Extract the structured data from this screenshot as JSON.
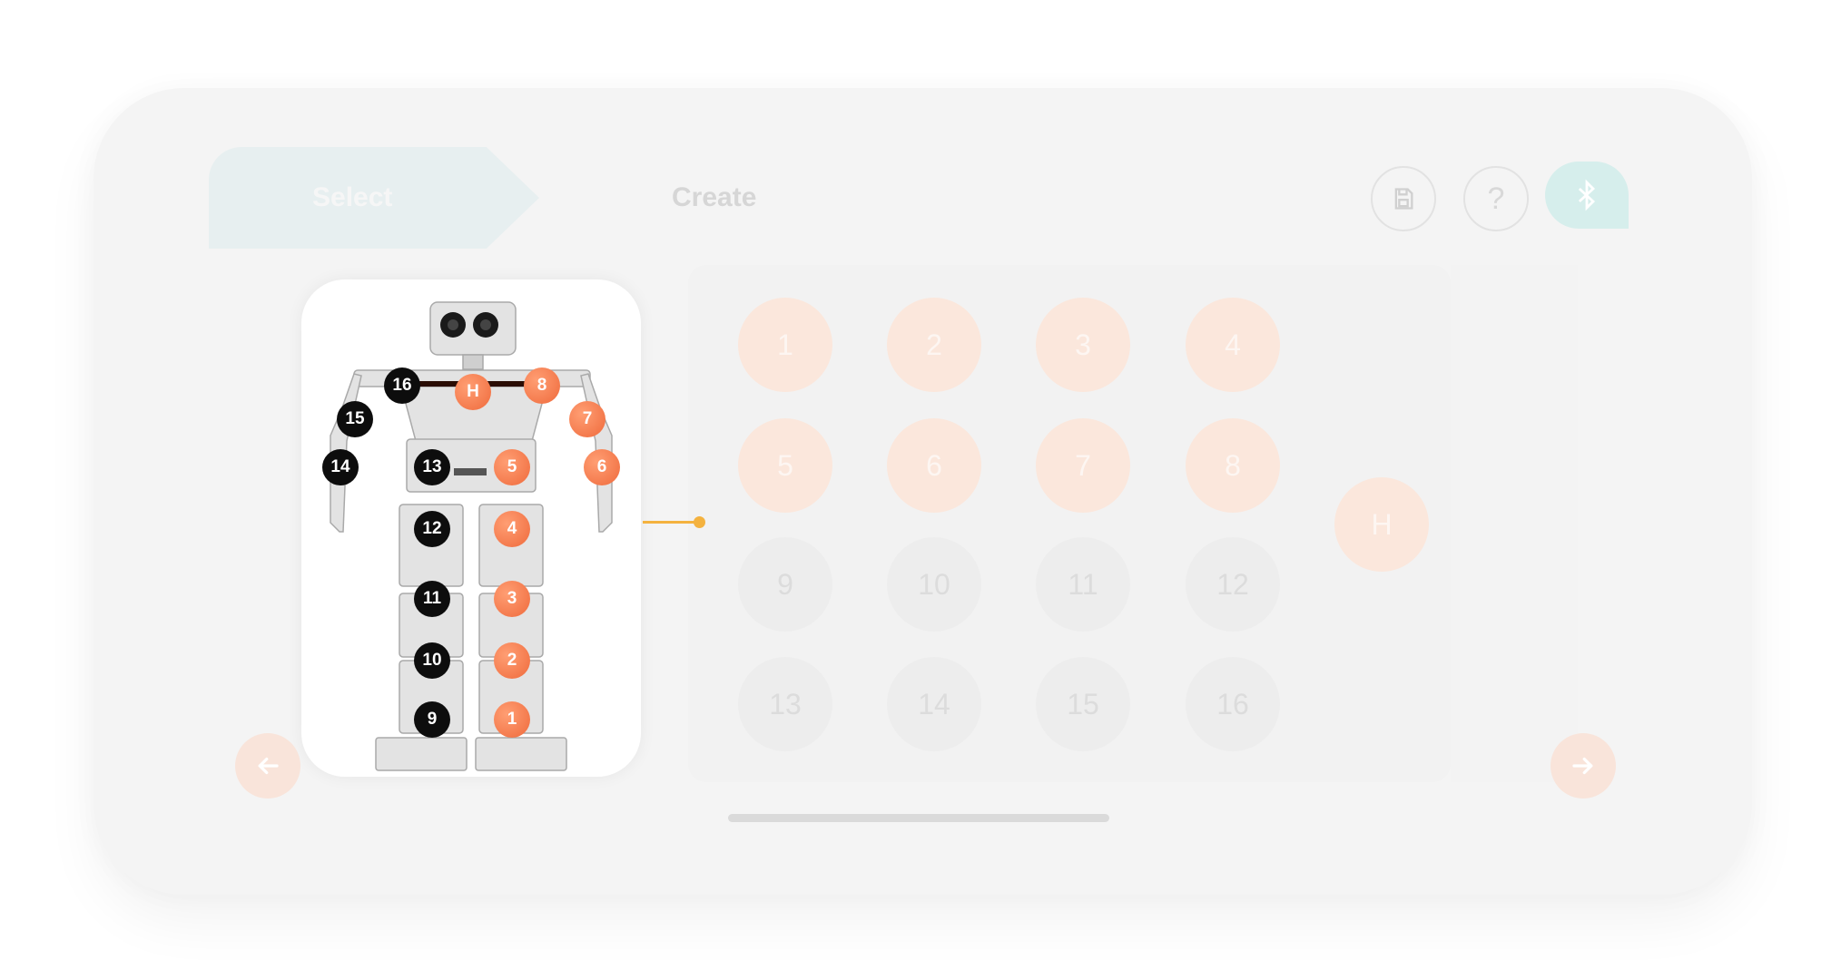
{
  "header": {
    "steps": [
      "Select",
      "Create"
    ],
    "tools": {
      "save_icon": "save-icon",
      "help_label": "?",
      "bluetooth_icon": "bluetooth-icon"
    }
  },
  "robot_markers": {
    "left": [
      "16",
      "15",
      "14",
      "13",
      "12",
      "11",
      "10",
      "9"
    ],
    "right": [
      "H",
      "8",
      "7",
      "6",
      "5",
      "4",
      "3",
      "2",
      "1"
    ]
  },
  "servo_grid": {
    "rows": [
      [
        "1",
        "2",
        "3",
        "4"
      ],
      [
        "5",
        "6",
        "7",
        "8"
      ],
      [
        "9",
        "10",
        "11",
        "12"
      ],
      [
        "13",
        "14",
        "15",
        "16"
      ]
    ],
    "extra": "H"
  },
  "nav": {
    "back_icon": "arrow-left-icon",
    "next_icon": "arrow-right-icon"
  },
  "colors": {
    "accent": "#ef6a3c",
    "connector": "#f4b23f",
    "bluetooth": "#d6eeec"
  }
}
